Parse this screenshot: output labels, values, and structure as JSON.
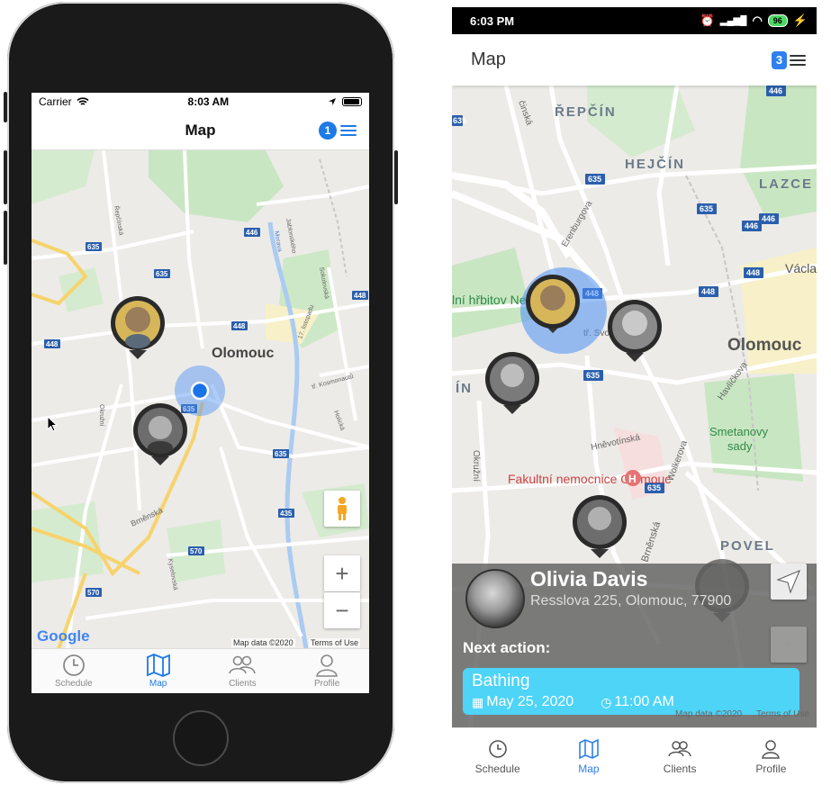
{
  "ios": {
    "status": {
      "carrier": "Carrier",
      "time": "8:03 AM"
    },
    "nav": {
      "title": "Map",
      "badge": "1"
    },
    "map": {
      "city": "Olomouc",
      "roads": [
        "635",
        "635",
        "446",
        "448",
        "448",
        "448",
        "635",
        "635",
        "435",
        "570",
        "570"
      ],
      "streets": [
        "Řepčínská",
        "Jablonského",
        "Morava",
        "Sokolovská",
        "17. listopadu",
        "tř. Kosmonautů",
        "Holická",
        "Okružní",
        "Brněnská",
        "Kyselovská"
      ],
      "attribution": "Map data ©2020",
      "terms": "Terms of Use",
      "google": "Google"
    },
    "tabs": [
      {
        "label": "Schedule",
        "icon": "clock-icon"
      },
      {
        "label": "Map",
        "icon": "map-icon"
      },
      {
        "label": "Clients",
        "icon": "people-icon"
      },
      {
        "label": "Profile",
        "icon": "person-icon"
      }
    ]
  },
  "android": {
    "status": {
      "time": "6:03 PM",
      "battery": "96"
    },
    "header": {
      "title": "Map",
      "badge": "3"
    },
    "map": {
      "districts": [
        "ŘEPČÍN",
        "HEJČÍN",
        "LAZCE",
        "Olomouc",
        "POVEL",
        "ÍN"
      ],
      "places": [
        "lní hřbitov Ne",
        "Fakultní nemocnice Olomouc",
        "Smetanovy sady",
        "Václa"
      ],
      "streets": [
        "Erenburgova",
        "Hněvotínská",
        "Wolkerova",
        "Okružní",
        "Brněnská",
        "Havlíčkova",
        "tř. Svo",
        "činská"
      ],
      "roads": [
        "446",
        "635",
        "635",
        "635",
        "446",
        "448",
        "448",
        "448",
        "635",
        "635",
        "446"
      ],
      "hospital_marker": "H",
      "attribution": "Map data ©2020",
      "terms": "Terms of Use"
    },
    "card": {
      "name": "Olivia Davis",
      "address": "Resslova 225, Olomouc, 77900",
      "next_label": "Next action:",
      "action": "Bathing",
      "date": "May 25, 2020",
      "time": "11:00 AM"
    },
    "tabs": [
      {
        "label": "Schedule",
        "icon": "clock-icon"
      },
      {
        "label": "Map",
        "icon": "map-icon"
      },
      {
        "label": "Clients",
        "icon": "people-icon"
      },
      {
        "label": "Profile",
        "icon": "person-icon"
      }
    ],
    "colors": {
      "accent": "#2f80ed",
      "action": "#4dd4f7"
    }
  }
}
